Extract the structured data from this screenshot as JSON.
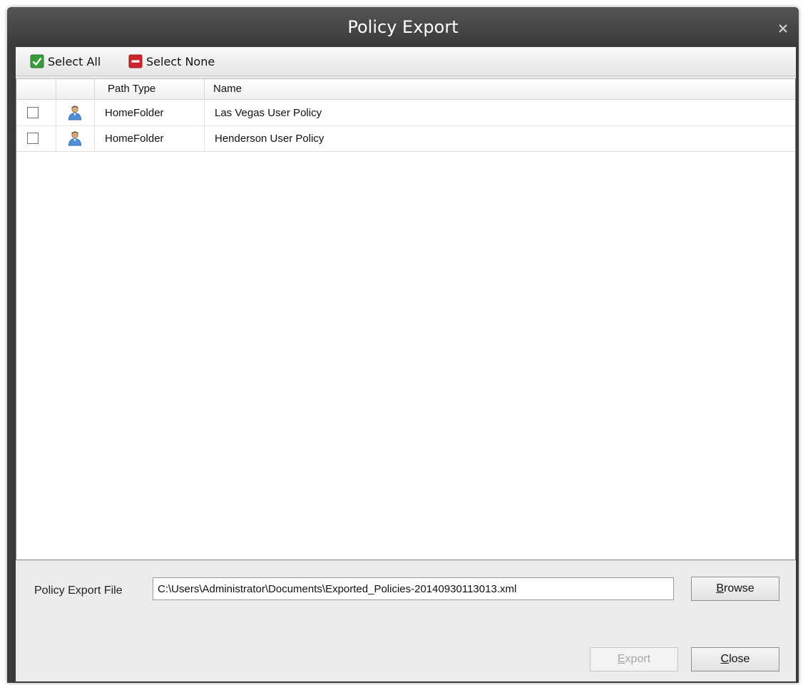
{
  "window": {
    "title": "Policy Export",
    "close_glyph": "x"
  },
  "toolbar": {
    "select_all_label": "Select All",
    "select_all_icon": "green-check-icon",
    "select_none_label": "Select None",
    "select_none_icon": "red-minus-icon"
  },
  "list": {
    "columns": [
      "",
      "",
      "Path Type",
      "Name"
    ],
    "rows": [
      {
        "checked": false,
        "icon": "user-icon",
        "path_type": "HomeFolder",
        "name": "Las Vegas User Policy"
      },
      {
        "checked": false,
        "icon": "user-icon",
        "path_type": "HomeFolder",
        "name": "Henderson User Policy"
      }
    ]
  },
  "export_file": {
    "label": "Policy Export File",
    "value": "C:\\Users\\Administrator\\Documents\\Exported_Policies-20140930113013.xml"
  },
  "buttons": {
    "browse_mnemonic": "B",
    "browse_rest": "rowse",
    "export_mnemonic": "E",
    "export_rest": "xport",
    "export_enabled": false,
    "close_mnemonic": "C",
    "close_rest": "lose"
  },
  "colors": {
    "titlebar": "#3a3a3a",
    "check_green": "#3b9a3b",
    "minus_red": "#c8262c"
  }
}
